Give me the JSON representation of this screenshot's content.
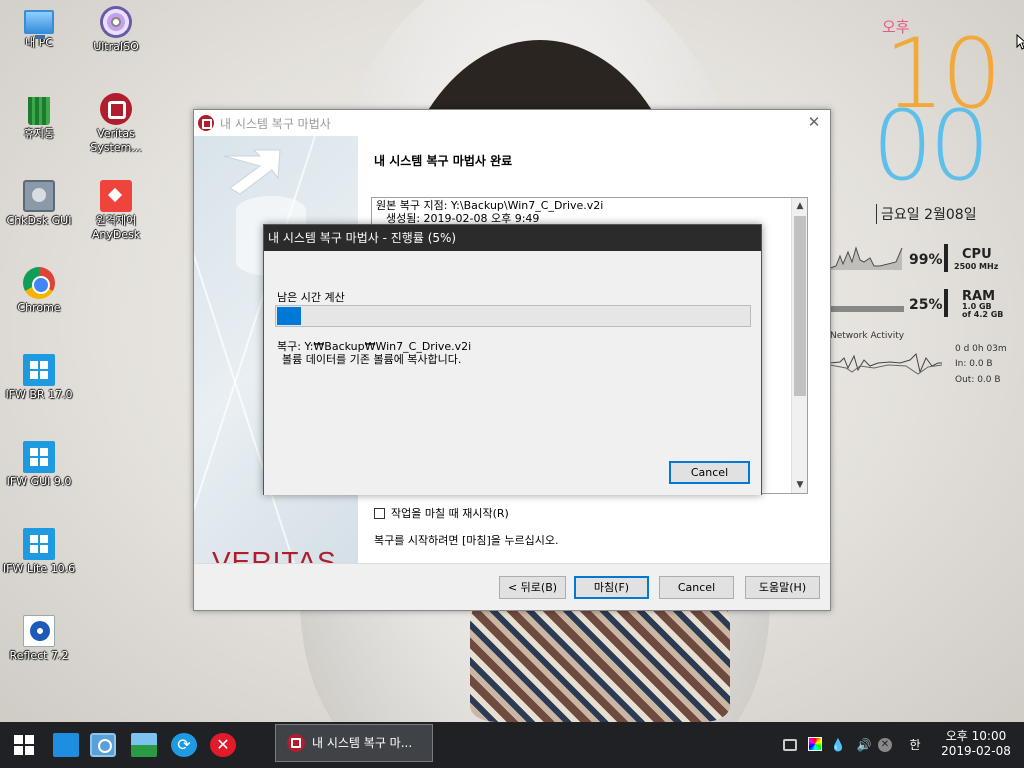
{
  "desktop": {
    "icons": [
      {
        "label": "내 PC",
        "icon": "pc-icon"
      },
      {
        "label": "UltraISO",
        "icon": "disc-icon"
      },
      {
        "label": "휴지통",
        "icon": "recycle-bin-icon"
      },
      {
        "label": "Veritas System...",
        "icon": "veritas-icon"
      },
      {
        "label": "ChkDsk GUI",
        "icon": "disk-icon"
      },
      {
        "label": "원격제어 AnyDesk",
        "icon": "anydesk-icon"
      },
      {
        "label": "Chrome",
        "icon": "chrome-icon"
      },
      {
        "label": "IFW BR 17.0",
        "icon": "windows-icon"
      },
      {
        "label": "IFW GUI 9.0",
        "icon": "windows-icon"
      },
      {
        "label": "IFW Lite 10.6",
        "icon": "windows-icon"
      },
      {
        "label": "Reflect 7.2",
        "icon": "reflect-icon"
      }
    ]
  },
  "clock_widget": {
    "ampm": "오후",
    "hour": "10",
    "minute": "00",
    "date": "금요일 2월08일",
    "colors": {
      "ampm": "#e35c7a",
      "hour": "#f2a93b",
      "minute": "#5ec0ea"
    }
  },
  "system_meter": {
    "cpu": {
      "percent": "99%",
      "name": "CPU",
      "sub": "2500 MHz"
    },
    "ram": {
      "percent": "25%",
      "name": "RAM",
      "sub1": "1.0 GB",
      "sub2": "of  4.2 GB"
    },
    "network": {
      "title": "Network Activity",
      "uptime": "0 d 0h 03m",
      "in": "In: 0.0 B",
      "out": "Out: 0.0 B"
    }
  },
  "wizard": {
    "title": "내 시스템 복구 마법사",
    "heading": "내 시스템 복구 마법사 완료",
    "logo": "VERITAS",
    "summary": {
      "line1": "원본 복구 지점:  Y:\\Backup\\Win7_C_Drive.v2i",
      "line2": "생성됨:  2019-02-08 오후 9:49"
    },
    "restart_checkbox": {
      "label": "작업을 마칠 때 재시작(R)",
      "checked": false
    },
    "instruction": "복구를 시작하려면 [마침]을 누르십시오.",
    "buttons": {
      "back": "< 뒤로(B)",
      "finish": "마침(F)",
      "cancel": "Cancel",
      "help": "도움말(H)"
    },
    "accent": "#b01e2e"
  },
  "progress_dialog": {
    "title": "내 시스템 복구 마법사 - 진행률  (5%)",
    "status": "남은 시간 계산",
    "percent": 5,
    "detail_line1": "복구: Y:₩Backup₩Win7_C_Drive.v2i",
    "detail_line2": "볼륨 데이터를 기존 볼륨에 복사합니다.",
    "cancel": "Cancel",
    "bar_color": "#0078d7"
  },
  "taskbar": {
    "pinned": [
      "start-icon",
      "desktop-icon",
      "explorer-icon",
      "photos-icon",
      "sync-icon",
      "cancel-icon"
    ],
    "active_app": "내 시스템 복구 마...",
    "tray": {
      "ime": "한",
      "volume_glyph": "🔊",
      "drop_glyph": "💧"
    },
    "time": "오후 10:00",
    "date": "2019-02-08"
  }
}
